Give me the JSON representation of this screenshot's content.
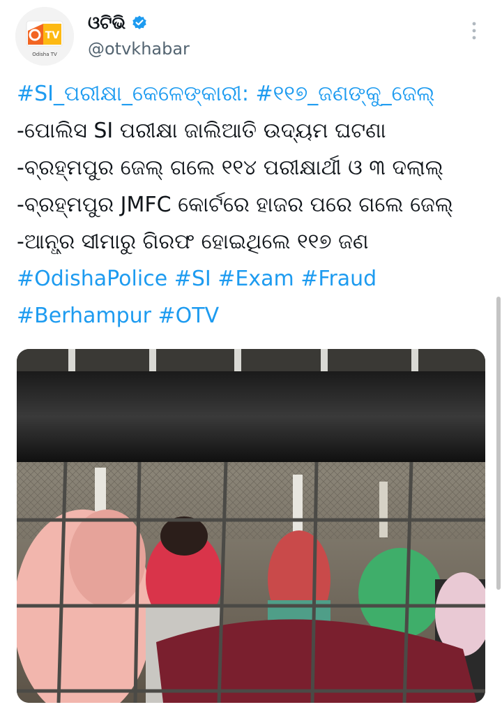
{
  "tweet": {
    "display_name": "ଓଟିଭି",
    "handle": "@otvkhabar",
    "avatar": {
      "logo_text": "TV",
      "caption": "Odisha TV"
    },
    "lines": [
      "#SI_ପରୀକ୍ଷା_କେଳେଙ୍କାରୀ: #୧୧୭_ଜଣଙ୍କୁ_ଜେଲ୍",
      "-ପୋଲିସ SI ପରୀକ୍ଷା ଜାଲିଆତି ଉଦ୍ୟମ ଘଟଣା",
      "-ବ୍ରହ୍ମପୁର ଜେଲ୍ ଗଲେ ୧୧୪ ପରୀକ୍ଷାର୍ଥୀ ଓ ୩ ଦଲାଲ୍",
      "-ବ୍ରହ୍ମପୁର JMFC କୋର୍ଟରେ ହାଜର ପରେ ଗଲେ ଜେଲ୍",
      "-ଆନ୍ଧ୍ର ସୀମାରୁ ଗିରଫ ହୋଇଥିଲେ ୧୧୭ ଜଣ",
      "#OdishaPolice #SI #Exam #Fraud",
      "#Berhampur #OTV"
    ]
  },
  "colors": {
    "link": "#1d9bf0",
    "text": "#0f1419",
    "secondary": "#536471",
    "verified": "#1d9bf0",
    "brand_orange": "#f26522",
    "brand_yellow": "#fdb913"
  },
  "icons": {
    "verified": "verified-badge-icon",
    "more": "more-vertical-icon"
  }
}
